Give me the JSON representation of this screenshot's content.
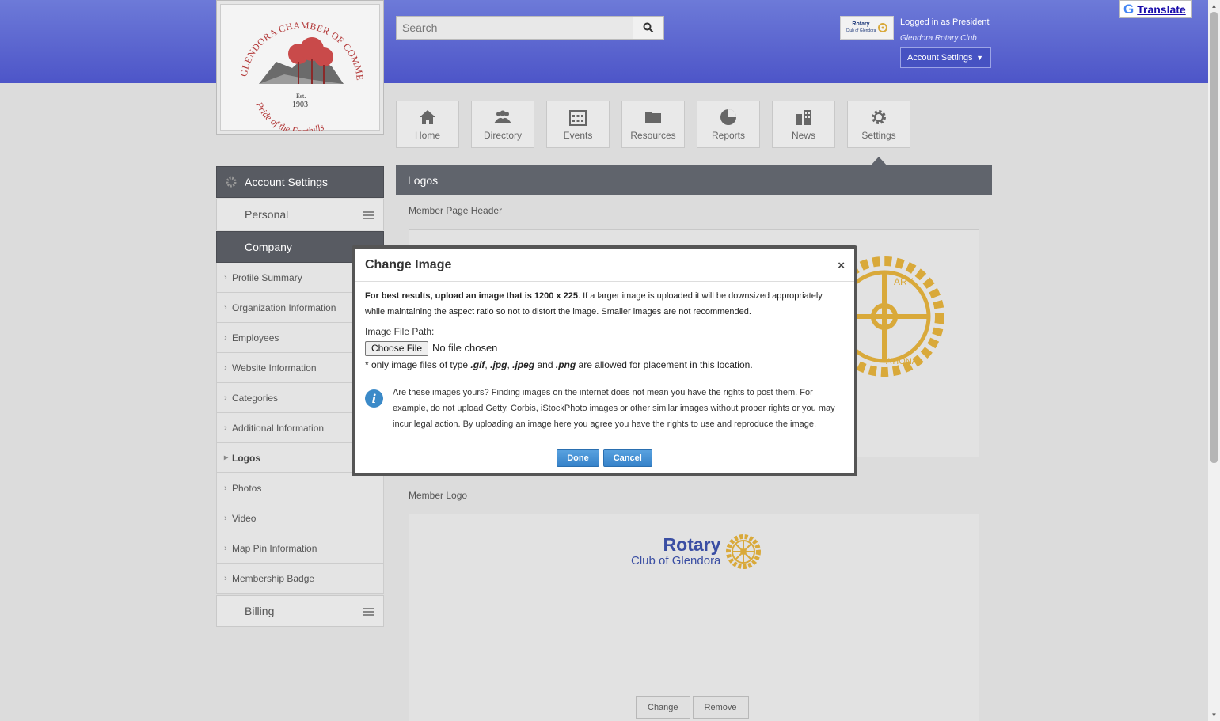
{
  "header": {
    "logo": {
      "arc_text": "GLENDORA CHAMBER OF COMMERCE",
      "est_label": "Est.",
      "est_year": "1903",
      "motto": "Pride of the Foothills"
    },
    "search": {
      "placeholder": "Search"
    },
    "account_badge_text": "Rotary",
    "account_badge_subtext": "Club of Glendora",
    "logged_in_text": "Logged in as President",
    "club_name": "Glendora Rotary Club",
    "account_button": "Account Settings"
  },
  "translate": {
    "label": "Translate"
  },
  "nav": [
    {
      "label": "Home",
      "icon": "home-icon"
    },
    {
      "label": "Directory",
      "icon": "people-icon"
    },
    {
      "label": "Events",
      "icon": "calendar-icon"
    },
    {
      "label": "Resources",
      "icon": "folder-icon"
    },
    {
      "label": "Reports",
      "icon": "pie-chart-icon"
    },
    {
      "label": "News",
      "icon": "buildings-icon"
    },
    {
      "label": "Settings",
      "icon": "gear-icon"
    }
  ],
  "sidebar": {
    "title": "Account Settings",
    "sections": {
      "personal": "Personal",
      "company": "Company",
      "billing": "Billing"
    },
    "items": [
      "Profile Summary",
      "Organization Information",
      "Employees",
      "Website Information",
      "Categories",
      "Additional Information",
      "Logos",
      "Photos",
      "Video",
      "Map Pin Information",
      "Membership Badge"
    ],
    "current_item": "Logos"
  },
  "content": {
    "title": "Logos",
    "member_page_header_label": "Member Page Header",
    "member_logo_label": "Member Logo",
    "logo_text_line1": "Rotary",
    "logo_text_line2": "Club of Glendora",
    "header_logo_text_1": "ARY",
    "header_logo_text_2": "ATIONAL",
    "change_button": "Change",
    "remove_button": "Remove"
  },
  "modal": {
    "title": "Change Image",
    "close": "×",
    "intro_bold": "For best results, upload an image that is 1200 x 225",
    "intro_rest": ". If a larger image is uploaded it will be downsized appropriately while maintaining the aspect ratio so not to distort the image. Smaller images are not recommended.",
    "file_path_label": "Image File Path:",
    "choose_file": "Choose File",
    "no_file": "No file chosen",
    "note_prefix": "* only image files of type",
    "ext_gif": ".gif",
    "comma": ",",
    "ext_jpg": ".jpg",
    "ext_jpeg": ".jpeg",
    "and": "and",
    "ext_png": ".png",
    "note_suffix": "are allowed for placement in this location.",
    "info_text": "Are these images yours? Finding images on the internet does not mean you have the rights to post them. For example, do not upload Getty, Corbis, iStockPhoto images or other similar images without proper rights or you may incur legal action. By uploading an image here you agree you have the rights to use and reproduce the image.",
    "done": "Done",
    "cancel": "Cancel"
  },
  "colors": {
    "header_gradient_top": "#6d7ad8",
    "header_gradient_bottom": "#4d55c8",
    "sidebar_active": "#585b62",
    "primary_button": "#3682c9",
    "rotary_gold": "#d9a93a",
    "rotary_blue": "#3a4ea3"
  }
}
